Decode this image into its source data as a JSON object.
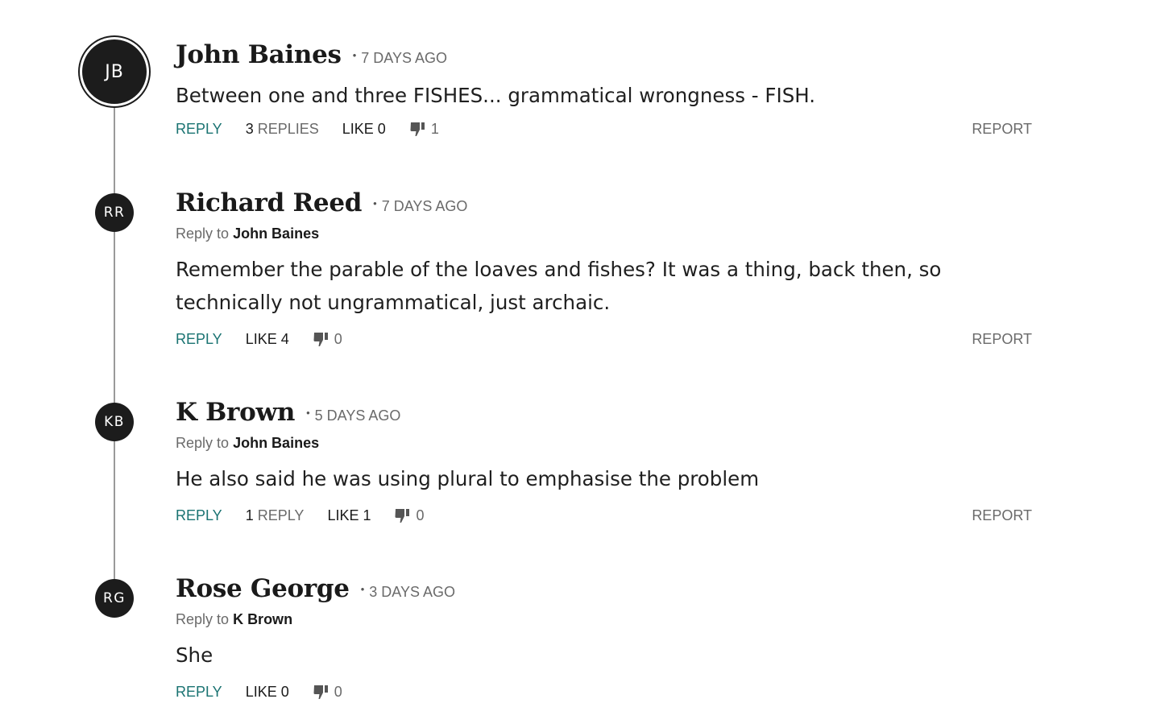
{
  "comments": [
    {
      "initials": "JB",
      "author": "John Baines",
      "time": "7 DAYS AGO",
      "reply_to_prefix": "",
      "reply_to": "",
      "body": "Between one and three FISHES... grammatical wrongness - FISH.",
      "reply_label": "REPLY",
      "replies_count": "3",
      "replies_label": "REPLIES",
      "like_label": "LIKE 0",
      "dislike_count": "1",
      "report_label": "REPORT"
    },
    {
      "initials": "RR",
      "author": "Richard Reed",
      "time": "7 DAYS AGO",
      "reply_to_prefix": "Reply to",
      "reply_to": "John Baines",
      "body": "Remember the parable of the loaves and fishes? It was a thing, back then, so technically not ungrammatical, just archaic.",
      "reply_label": "REPLY",
      "like_label": "LIKE 4",
      "dislike_count": "0",
      "report_label": "REPORT"
    },
    {
      "initials": "KB",
      "author": "K Brown",
      "time": "5 DAYS AGO",
      "reply_to_prefix": "Reply to",
      "reply_to": "John Baines",
      "body": "He also said he was using plural to emphasise the problem",
      "reply_label": "REPLY",
      "replies_count": "1",
      "replies_label": "REPLY",
      "like_label": "LIKE 1",
      "dislike_count": "0",
      "report_label": "REPORT"
    },
    {
      "initials": "RG",
      "author": "Rose George",
      "time": "3 DAYS AGO",
      "reply_to_prefix": "Reply to",
      "reply_to": "K Brown",
      "body": "She",
      "reply_label": "REPLY",
      "like_label": "LIKE 0",
      "dislike_count": "0"
    }
  ],
  "colors": {
    "reply_accent": "#1a7372",
    "avatar_bg": "#1c1c1c",
    "thread_line": "#9a9a9a"
  },
  "icons": {
    "dislike": "thumbs-down-icon"
  }
}
